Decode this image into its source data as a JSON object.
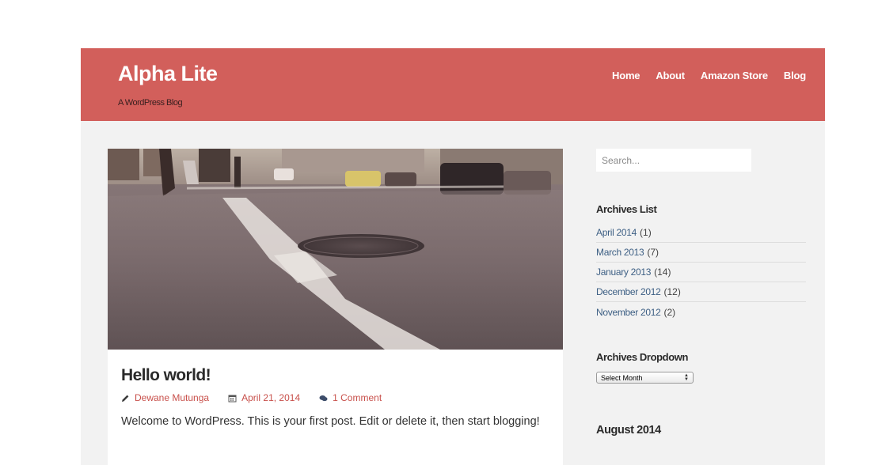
{
  "header": {
    "site_title": "Alpha Lite",
    "site_description": "A WordPress Blog",
    "nav": [
      {
        "label": "Home"
      },
      {
        "label": "About"
      },
      {
        "label": "Amazon Store"
      },
      {
        "label": "Blog"
      }
    ],
    "background_color": "#d25f5b"
  },
  "post": {
    "title": "Hello world!",
    "author": "Dewane Mutunga",
    "date": "April 21, 2014",
    "comments": "1 Comment",
    "excerpt": "Welcome to WordPress. This is your first post. Edit or delete it, then start blogging!",
    "icons": {
      "author": "pencil-icon",
      "date": "calendar-icon",
      "comments": "comments-icon"
    },
    "meta_color": "#c8504b"
  },
  "sidebar": {
    "search": {
      "placeholder": "Search..."
    },
    "archives_list": {
      "title": "Archives List",
      "items": [
        {
          "label": "April 2014",
          "count": "(1)"
        },
        {
          "label": "March 2013",
          "count": "(7)"
        },
        {
          "label": "January 2013",
          "count": "(14)"
        },
        {
          "label": "December 2012",
          "count": "(12)"
        },
        {
          "label": "November 2012",
          "count": "(2)"
        }
      ]
    },
    "archives_dropdown": {
      "title": "Archives Dropdown",
      "selected": "Select Month"
    },
    "calendar": {
      "title": "August 2014"
    }
  }
}
